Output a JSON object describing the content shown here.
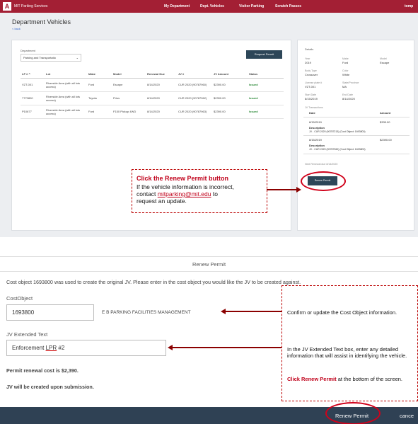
{
  "navbar": {
    "logo": "A",
    "brand": "MIT Parking Services",
    "links": [
      "My Department",
      "Dept. Vehicles",
      "Visitor Parking",
      "Scratch Passes"
    ],
    "user": "tomp"
  },
  "page": {
    "title": "Department Vehicles",
    "back": "< back"
  },
  "filters": {
    "department_label": "Department",
    "department_value": "Parking and Transportatio",
    "request_button": "Request Permit"
  },
  "table": {
    "headers": [
      "LP # ^",
      "Lot",
      "Make",
      "Model",
      "Renewal Due",
      "JV #",
      "JV Amount",
      "Status"
    ],
    "rows": [
      [
        "VZT-001",
        "Riverside Area (with all lots access)",
        "Ford",
        "Escape",
        "8/14/2020",
        "CUR 2020 (90787960)",
        "$2390.00",
        "Issued"
      ],
      [
        "7770800",
        "Riverside Area (with all lots access)",
        "Toyota",
        "Prius",
        "8/14/2020",
        "CUR 2020 (90787962)",
        "$2390.00",
        "Issued"
      ],
      [
        "P10677",
        "Riverside Area (with all lots access)",
        "Ford",
        "F150 Pickup 4WD",
        "8/14/2020",
        "CUR 2020 (90787963)",
        "$2390.00",
        "Issued"
      ]
    ]
  },
  "details": {
    "title": "Details",
    "fields": [
      {
        "label": "Year",
        "value": "2019"
      },
      {
        "label": "Make",
        "value": "Ford"
      },
      {
        "label": "Model",
        "value": "Escape"
      },
      {
        "label": "Body Type",
        "value": "Crossover"
      },
      {
        "label": "Color",
        "value": "White"
      },
      {
        "label": "License plate #",
        "value": "VZT-001"
      },
      {
        "label": "State/Province",
        "value": "MA"
      },
      {
        "label": "Start Date",
        "value": "8/15/2019"
      },
      {
        "label": "End Date",
        "value": "8/14/2020"
      }
    ],
    "jv_heading": "JV Transactions",
    "jv_col_date": "Date",
    "jv_col_amount": "Amount",
    "jv_rows": [
      {
        "date": "8/15/2019",
        "amount": "$335.00",
        "desc_label": "Description",
        "desc": "JV - CUR 2020 (90787213) (Cost Object: 1693800)"
      },
      {
        "date": "8/15/2019",
        "amount": "$2390.00",
        "desc_label": "Description",
        "desc": "JV - CUR 2020 (90787960) (Cost Object: 1693800)"
      }
    ],
    "next_renewal": "Next Renewal due 8/14/2020",
    "renew_button": "Renew Permit"
  },
  "callout_top": {
    "title": "Click the Renew Permit button",
    "line1": "If the vehicle information is incorrect,",
    "line2_pre": "contact",
    "email": "mitparking@mit.edu",
    "line2_post": "to",
    "line3": "request an update."
  },
  "modal": {
    "title": "Renew Permit",
    "description": "Cost object 1693800 was used to create the original JV. Please enter in the cost object you would like the JV to be created against.",
    "cost_object_label": "CostObject",
    "cost_object_value": "1693800",
    "cost_object_name": "E B PARKING FACILITIES MANAGEMENT",
    "jv_label": "JV Extended Text",
    "jv_value_prefix": "Enforcement ",
    "jv_value_underlined": "LPR",
    "jv_value_suffix": " #2",
    "cost_text": "Permit renewal cost is $2,390.",
    "submit_text": "JV will be created upon submission.",
    "renew_button": "Renew Permit",
    "cancel": "cance"
  },
  "callout_bottom": {
    "c1": "Confirm or update the Cost Object information.",
    "c2": "In the JV Extended Text box, enter any detailed information that will assist in identifying the vehicle.",
    "c3_red": "Click Renew Permit",
    "c3_rest": " at the bottom of the screen."
  },
  "colors": {
    "brand": "#a31f34",
    "navy": "#2d4658",
    "annotation": "#c0001a",
    "issued": "#2e8b3a"
  }
}
